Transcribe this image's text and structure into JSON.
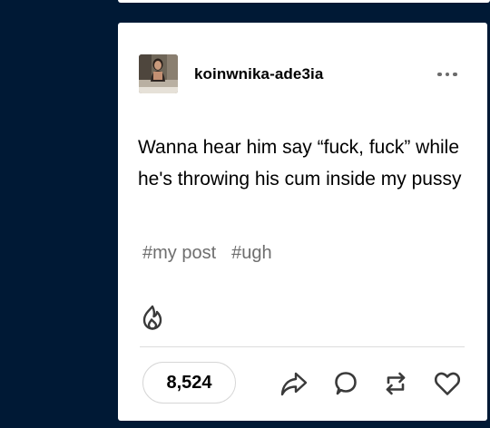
{
  "post": {
    "username": "koinwnika-ade3ia",
    "body": "Wanna hear him say “fuck, fuck” while he's throwing his cum inside my pussy",
    "tags": [
      "#my post",
      "#ugh"
    ],
    "notes_count": "8,524"
  },
  "icons": {
    "more": "more-options-icon",
    "flame": "flame-icon",
    "share": "share-icon",
    "reply": "reply-icon",
    "reblog": "reblog-icon",
    "like": "heart-icon"
  },
  "colors": {
    "dashboard_background": "#001935",
    "card_background": "#ffffff",
    "text": "#000000",
    "tag_text": "#6e6e6e",
    "icon": "#3a3a3a"
  }
}
